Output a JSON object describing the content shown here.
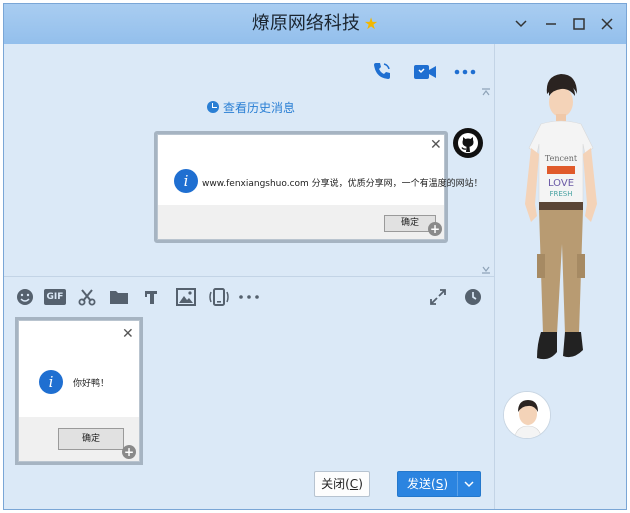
{
  "window": {
    "title": "燎原网络科技"
  },
  "toolbar_top": {
    "icons": [
      "phone-icon",
      "video-call-icon",
      "more-icon"
    ]
  },
  "chat": {
    "history_link": "查看历史消息",
    "message_dialog": {
      "text": "www.fenxiangshuo.com 分享说，优质分享网，一个有温度的网站！",
      "ok_label": "确定"
    }
  },
  "input_toolbar": {
    "icons": [
      "emoji-icon",
      "gif-icon",
      "scissors-icon",
      "folder-icon",
      "font-icon",
      "image-icon",
      "shake-icon",
      "more-icon",
      "expand-icon",
      "history-clock-icon"
    ],
    "gif_label": "GIF"
  },
  "draft": {
    "dialog_text": "你好鸭！",
    "ok_label": "确定"
  },
  "footer": {
    "close_label": "关闭(",
    "close_key": "C",
    "close_suffix": ")",
    "send_label": "发送(",
    "send_key": "S",
    "send_suffix": ")"
  },
  "colors": {
    "accent": "#2b84e0",
    "titlebar": "#a9cdf1",
    "panel": "#dbe9f7"
  }
}
